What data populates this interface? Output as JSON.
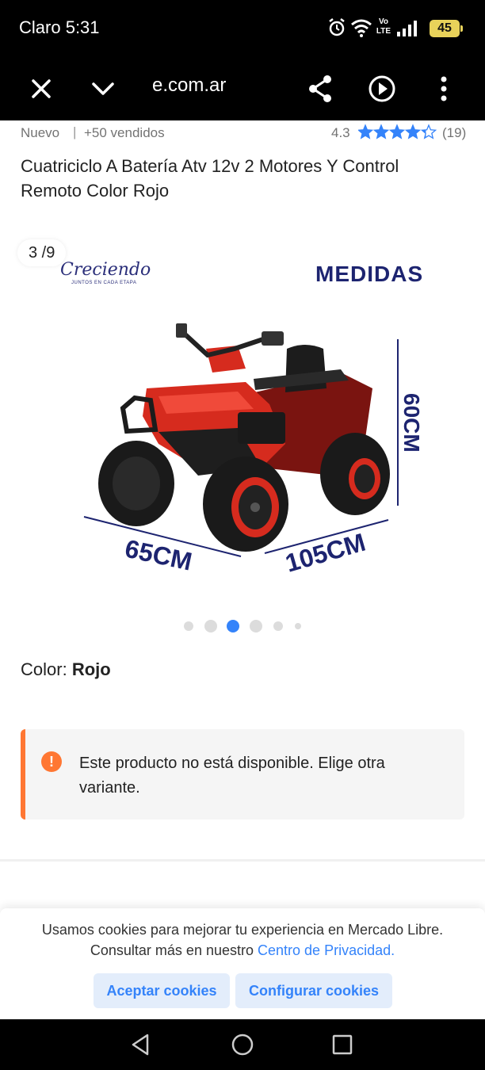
{
  "status_bar": {
    "carrier": "Claro",
    "time": "5:31",
    "network": "Vo LTE",
    "battery": "45"
  },
  "browser": {
    "url": "e.com.ar"
  },
  "product": {
    "condition": "Nuevo",
    "separator": "|",
    "sold": "+50 vendidos",
    "rating": "4.3",
    "stars": 4.3,
    "reviews": "(19)",
    "title": "Cuatriciclo A Batería Atv 12v 2 Motores Y Control Remoto Color Rojo"
  },
  "gallery": {
    "counter": "3 /9",
    "brand": "Creciendo",
    "brand_tagline": "JUNTOS EN CADA ETAPA",
    "heading": "MEDIDAS",
    "dim_width": "65CM",
    "dim_length": "105CM",
    "dim_height": "60CM",
    "current_index": 3,
    "total_dots": 6
  },
  "color": {
    "label": "Color:",
    "value": "Rojo"
  },
  "notice": {
    "icon": "!",
    "text": "Este producto no está disponible. Elige otra variante."
  },
  "cookies": {
    "text": "Usamos cookies para mejorar tu experiencia en Mercado Libre. Consultar más en nuestro",
    "link": "Centro de Privacidad.",
    "accept": "Aceptar cookies",
    "configure": "Configurar cookies"
  },
  "colors": {
    "accent_blue": "#3483fa",
    "warning_orange": "#ff7733",
    "star_blue": "#3483fa",
    "vehicle_red": "#d62b1e"
  }
}
